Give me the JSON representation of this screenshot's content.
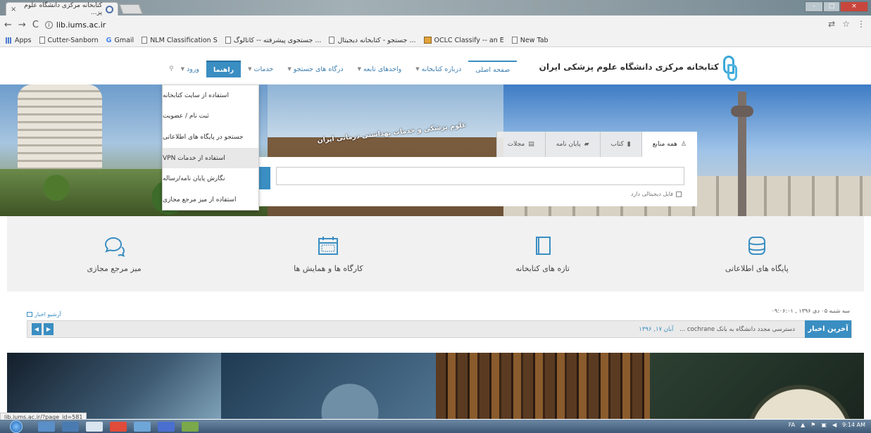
{
  "browser": {
    "tab_title": "کتابخانه مرکزی دانشگاه علوم پز...",
    "tab_close": "×",
    "url": "lib.iums.ac.ir",
    "bookmarks": [
      {
        "label": "Apps",
        "icon": "apps-grid-icon"
      },
      {
        "label": "Cutter-Sanborn",
        "icon": "page-icon"
      },
      {
        "label": "Gmail",
        "icon": "google-icon"
      },
      {
        "label": "NLM Classification S",
        "icon": "page-icon"
      },
      {
        "label": "جستجوی پیشرفته -- کاتالوگ ...",
        "icon": "page-icon"
      },
      {
        "label": "جستجو - کتابخانه دیجیتال ...",
        "icon": "page-icon"
      },
      {
        "label": "OCLC Classify -- an E",
        "icon": "oclc-icon"
      },
      {
        "label": "New Tab",
        "icon": "page-icon"
      }
    ]
  },
  "site": {
    "logo_text": "کتابخانه مرکزی دانشگاه علوم پزشکی ایران",
    "nav": [
      {
        "label": "صفحه اصلی",
        "caret": false
      },
      {
        "label": "درباره کتابخانه",
        "caret": true
      },
      {
        "label": "واحدهای تابعه",
        "caret": true
      },
      {
        "label": "درگاه های جستجو",
        "caret": true
      },
      {
        "label": "خدمات",
        "caret": true
      },
      {
        "label": "راهنما",
        "caret": false
      },
      {
        "label": "ورود",
        "caret": true
      }
    ],
    "search_icon": "⚲"
  },
  "dropdown": {
    "items": [
      "استفاده از سایت کتابخانه",
      "ثبت نام / عضویت",
      "جستجو در پایگاه های اطلاعاتی",
      "استفاده از خدمات VPN",
      "نگارش پایان نامه/رساله",
      "استفاده از میز مرجع مجازی"
    ]
  },
  "hero": {
    "gate_sign": "علوم پزشکی و خدمات بهداشتی درمانی ایران"
  },
  "search": {
    "tabs": [
      {
        "label": "همه منابع",
        "icon": "user-icon"
      },
      {
        "label": "کتاب",
        "icon": "book-icon"
      },
      {
        "label": "پایان نامه",
        "icon": "cap-icon"
      },
      {
        "label": "مجلات",
        "icon": "journal-icon"
      }
    ],
    "input_value": "",
    "checkbox_label": "فایل دیجیتالی دارد"
  },
  "services": [
    {
      "label": "پایگاه های اطلاعاتی",
      "icon": "database-icon"
    },
    {
      "label": "تازه های کتابخانه",
      "icon": "book-icon"
    },
    {
      "label": "کارگاه ها و همایش ها",
      "icon": "calendar-icon"
    },
    {
      "label": "میز مرجع مجازی",
      "icon": "chat-bubbles-icon"
    }
  ],
  "news": {
    "date": "سه شنبه ۰۵ دی ۱۳۹۶ , ۰۹:۰۶:۰۱",
    "archive_label": "آرشیو اخبار",
    "label": "آخرین اخبار",
    "item_text": "دسترسی مجدد دانشگاه به بانک cochrane ...",
    "item_date": "آبان ۱۷, ۱۳۹۶",
    "prev": "◀",
    "next": "▶"
  },
  "status": {
    "url": "lib.iums.ac.ir/?page_id=581"
  },
  "taskbar": {
    "lang": "FA",
    "time": "9:14 AM"
  }
}
